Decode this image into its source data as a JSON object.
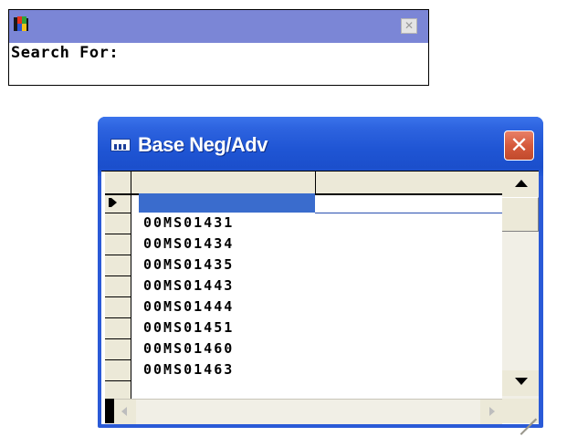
{
  "search_window": {
    "close_glyph": "✕",
    "label": "Search For:"
  },
  "grid_window": {
    "title": "Base Neg/Adv",
    "close_glyph": "✕",
    "icon": "grid-window-icon",
    "rows": [
      "00MS01431",
      "00MS01434",
      "00MS01435",
      "00MS01443",
      "00MS01444",
      "00MS01451",
      "00MS01460",
      "00MS01463"
    ]
  },
  "colors": {
    "search_titlebar": "#7b86d6",
    "xp_title_blue": "#2a5ad7",
    "xp_close_red": "#d65a3c",
    "selection_blue": "#3a6ccd"
  }
}
